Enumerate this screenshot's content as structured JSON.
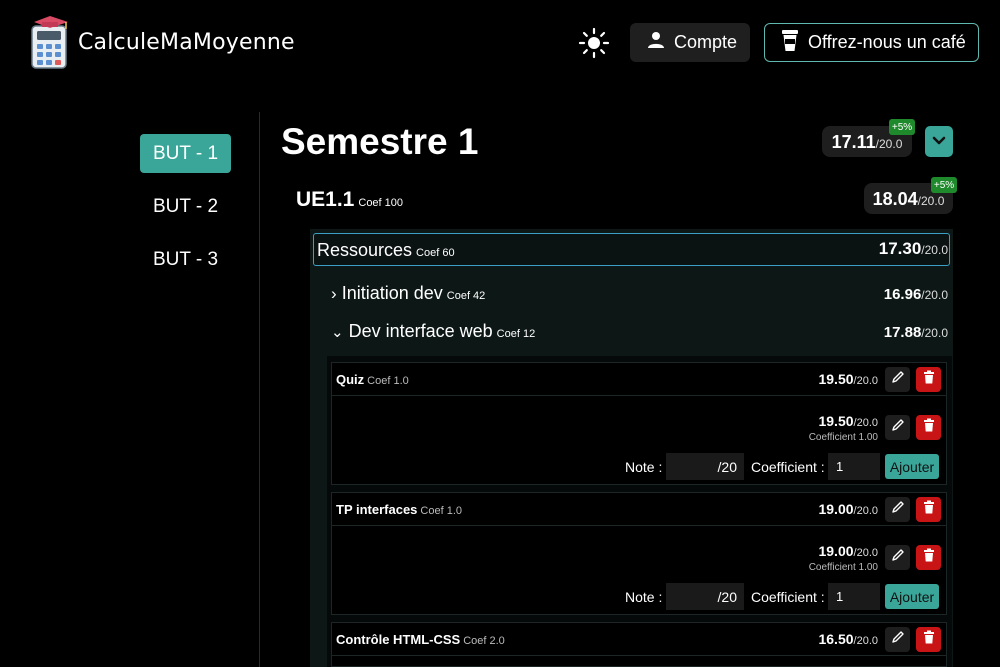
{
  "app": {
    "title": "CalculeMaMoyenne"
  },
  "header": {
    "account_label": "Compte",
    "coffee_label": "Offrez-nous un café"
  },
  "sidebar": {
    "items": [
      {
        "label": "BUT - 1",
        "active": true
      },
      {
        "label": "BUT - 2",
        "active": false
      },
      {
        "label": "BUT - 3",
        "active": false
      }
    ]
  },
  "semester": {
    "title": "Semestre 1",
    "average": "17.11",
    "max": "/20.0",
    "bonus": "+5%"
  },
  "ue": {
    "title": "UE1.1",
    "coef": "Coef 100",
    "average": "18.04",
    "max": "/20.0",
    "bonus": "+5%"
  },
  "resources": {
    "title": "Ressources",
    "coef": "Coef 60",
    "average": "17.30",
    "max": "/20.0",
    "modules": [
      {
        "chevron": "›",
        "name": "Initiation dev",
        "coef": "Coef 42",
        "average": "16.96",
        "max": "/20.0"
      },
      {
        "chevron": "⌄",
        "name": "Dev interface web",
        "coef": "Coef 12",
        "average": "17.88",
        "max": "/20.0"
      }
    ]
  },
  "evaluations": [
    {
      "name": "Quiz",
      "coef": "Coef 1.0",
      "score": "19.50",
      "max": "/20.0",
      "grade": "19.50",
      "grade_max": "/20.0",
      "grade_coef": "Coefficient 1.00",
      "form": {
        "note_label": "Note :",
        "note_suffix": "/20",
        "coef_label": "Coefficient :",
        "coef_value": "1",
        "add_label": "Ajouter"
      }
    },
    {
      "name": "TP interfaces",
      "coef": "Coef 1.0",
      "score": "19.00",
      "max": "/20.0",
      "grade": "19.00",
      "grade_max": "/20.0",
      "grade_coef": "Coefficient 1.00",
      "form": {
        "note_label": "Note :",
        "note_suffix": "/20",
        "coef_label": "Coefficient :",
        "coef_value": "1",
        "add_label": "Ajouter"
      }
    },
    {
      "name": "Contrôle HTML-CSS",
      "coef": "Coef 2.0",
      "score": "16.50",
      "max": "/20.0"
    }
  ],
  "colors": {
    "accent": "#3aa69a",
    "danger": "#c81414",
    "bonus": "#1f8a2c",
    "focus_border": "#3aa0c4"
  }
}
